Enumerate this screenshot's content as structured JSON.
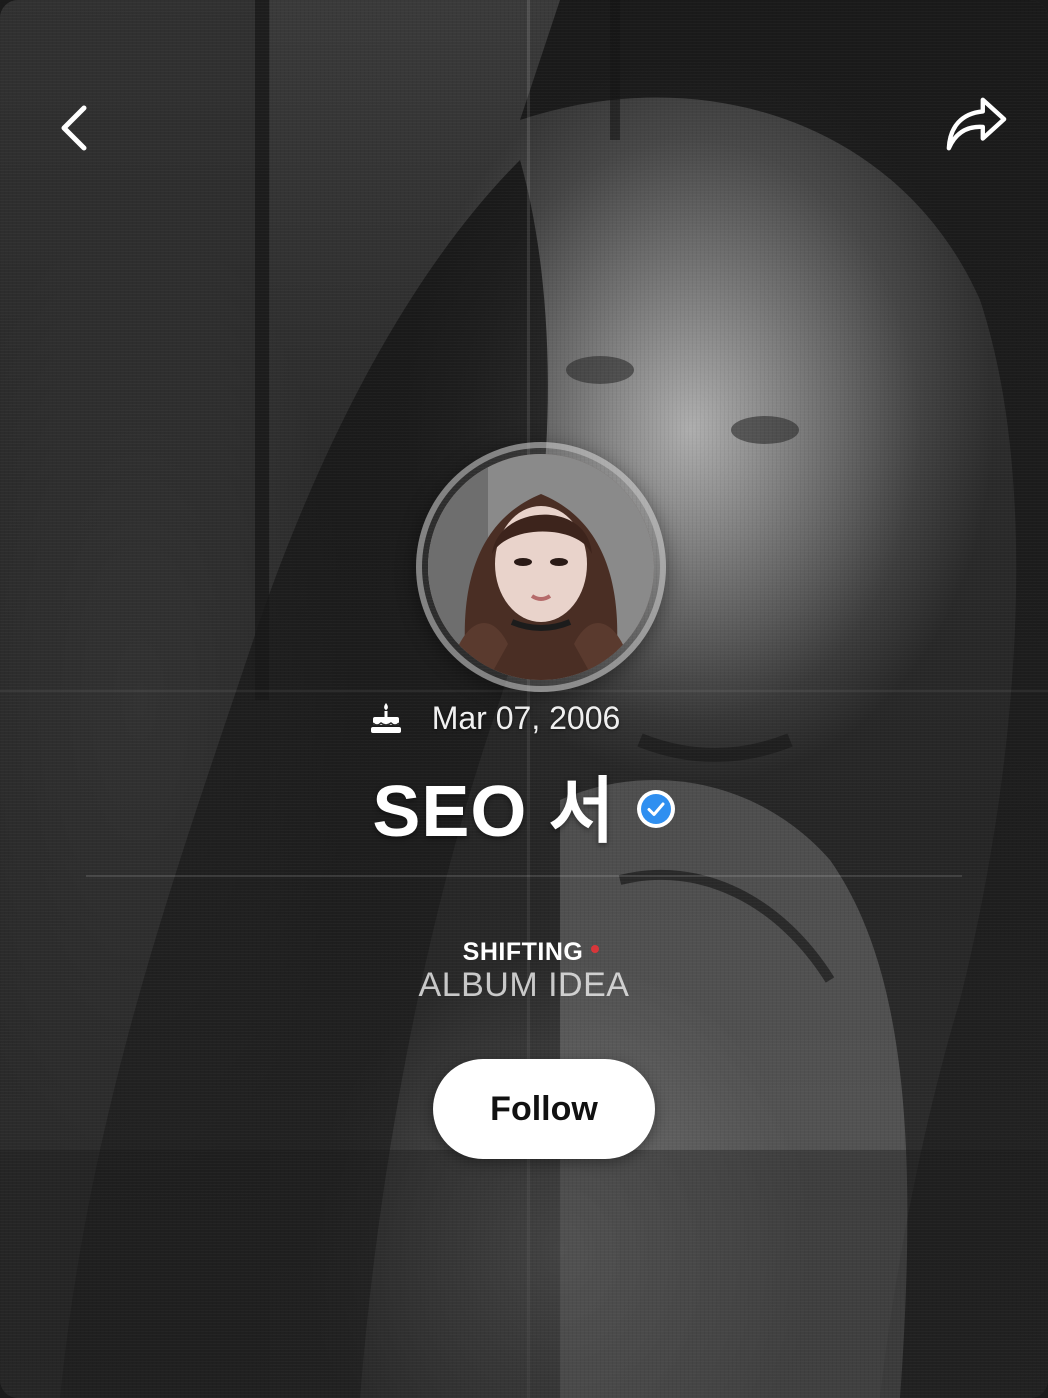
{
  "profile": {
    "birthday": "Mar 07, 2006",
    "name": "SEO 서",
    "verified": true
  },
  "now_playing": {
    "title": "SHIFTING",
    "subtitle": "ALBUM IDEA"
  },
  "actions": {
    "follow_label": "Follow"
  },
  "icons": {
    "back": "chevron-left-icon",
    "share": "share-arrow-icon",
    "birthday": "cake-icon",
    "verified": "verified-badge-icon"
  },
  "colors": {
    "verified_blue": "#2f8ff0",
    "live_dot": "#d8363a",
    "follow_bg": "#ffffff"
  }
}
